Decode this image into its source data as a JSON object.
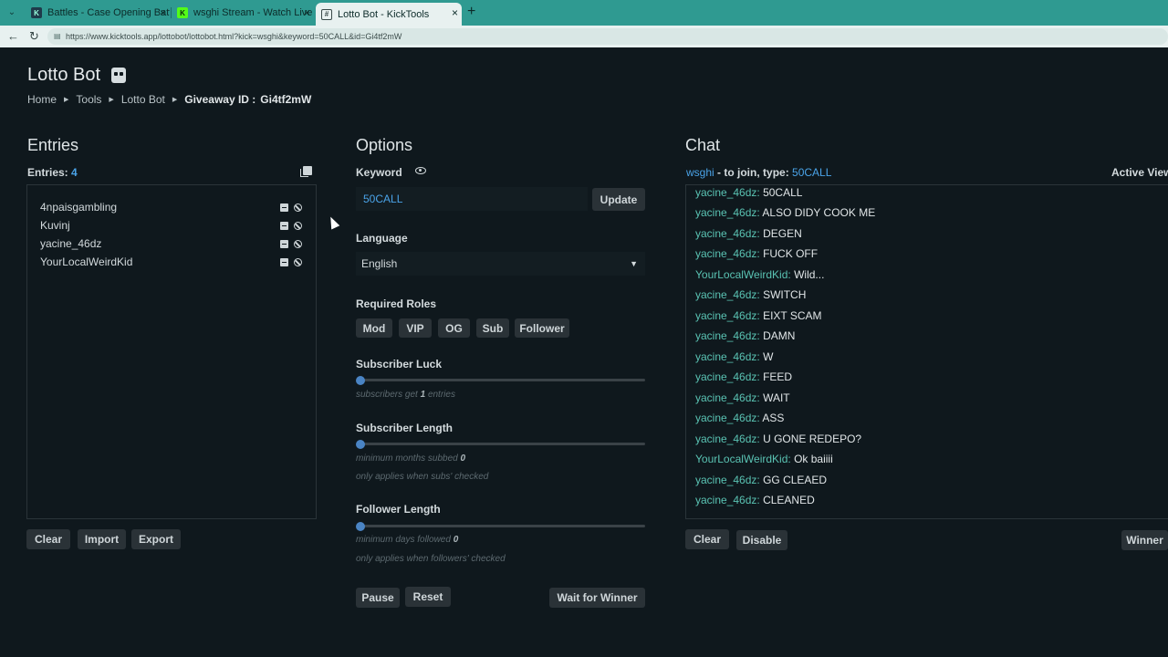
{
  "browser": {
    "tabs": [
      {
        "title": "Battles - Case Opening Battles",
        "favicon": "K"
      },
      {
        "title": "wsghi Stream - Watch Live on Kick",
        "favicon": "K"
      },
      {
        "title": "Lotto Bot - KickTools",
        "favicon": "#"
      }
    ],
    "url": "https://www.kicktools.app/lottobot/lottobot.html?kick=wsghi&keyword=50CALL&id=Gi4tf2mW"
  },
  "page": {
    "title": "Lotto Bot",
    "breadcrumb": {
      "home": "Home",
      "tools": "Tools",
      "lotto": "Lotto Bot",
      "giveaway_label": "Giveaway ID :",
      "giveaway_id": "Gi4tf2mW"
    }
  },
  "entries": {
    "heading": "Entries",
    "count_label": "Entries:",
    "count": "4",
    "items": [
      "4npaisgambling",
      "Kuvinj",
      "yacine_46dz",
      "YourLocalWeirdKid"
    ],
    "buttons": {
      "clear": "Clear",
      "import": "Import",
      "export": "Export"
    }
  },
  "options": {
    "heading": "Options",
    "keyword_label": "Keyword",
    "keyword_value": "50CALL",
    "update": "Update",
    "language_label": "Language",
    "language_value": "English",
    "roles_label": "Required Roles",
    "roles": [
      "Mod",
      "VIP",
      "OG",
      "Sub",
      "Follower"
    ],
    "sub_luck_label": "Subscriber Luck",
    "sub_luck_hint_pre": "subscribers get",
    "sub_luck_value": "1",
    "sub_luck_hint_post": "entries",
    "sub_length_label": "Subscriber Length",
    "sub_length_hint": "minimum months subbed",
    "sub_length_value": "0",
    "sub_length_note": "only applies when subs' checked",
    "follower_length_label": "Follower Length",
    "follower_length_hint": "minimum days followed",
    "follower_length_value": "0",
    "follower_length_note": "only applies when followers' checked",
    "pause": "Pause",
    "reset": "Reset",
    "wait": "Wait for Winner"
  },
  "chat": {
    "heading": "Chat",
    "channel": "wsghi",
    "join_text": "- to join, type:",
    "keyword": "50CALL",
    "active_view": "Active View",
    "messages": [
      {
        "user": "yacine_46dz:",
        "text": "50CALL"
      },
      {
        "user": "yacine_46dz:",
        "text": "ALSO DIDY COOK ME"
      },
      {
        "user": "yacine_46dz:",
        "text": "DEGEN"
      },
      {
        "user": "yacine_46dz:",
        "text": "FUCK OFF"
      },
      {
        "user": "YourLocalWeirdKid:",
        "text": "Wild..."
      },
      {
        "user": "yacine_46dz:",
        "text": "SWITCH"
      },
      {
        "user": "yacine_46dz:",
        "text": "EIXT SCAM"
      },
      {
        "user": "yacine_46dz:",
        "text": "DAMN"
      },
      {
        "user": "yacine_46dz:",
        "text": "W"
      },
      {
        "user": "yacine_46dz:",
        "text": "FEED"
      },
      {
        "user": "yacine_46dz:",
        "text": "WAIT"
      },
      {
        "user": "yacine_46dz:",
        "text": "ASS"
      },
      {
        "user": "yacine_46dz:",
        "text": "U GONE REDEPO?"
      },
      {
        "user": "YourLocalWeirdKid:",
        "text": "Ok baiiii"
      },
      {
        "user": "yacine_46dz:",
        "text": "GG CLEAED"
      },
      {
        "user": "yacine_46dz:",
        "text": "CLEANED"
      }
    ],
    "buttons": {
      "clear": "Clear",
      "disable": "Disable",
      "winner": "Winner"
    }
  },
  "colors": {
    "accent": "#4aa3e8",
    "username": "#5ac3b3",
    "tabbar": "#2f9a91",
    "background": "#0f181d"
  }
}
